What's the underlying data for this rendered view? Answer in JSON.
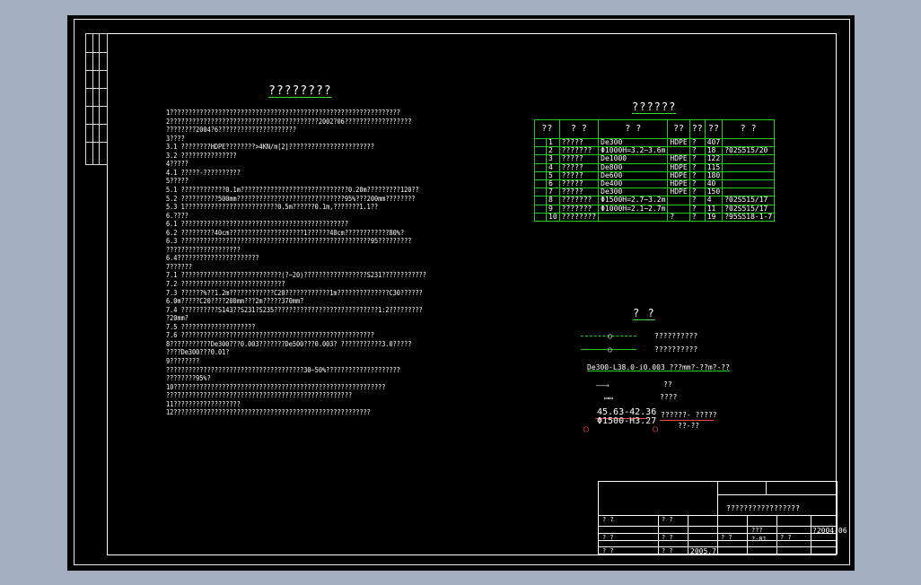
{
  "title": "????????",
  "notes": [
    "1??????????????????????????????????????????????????????????????",
    " 2????????????????????????????????????????2002?06??????????????????",
    "   ????????2004?6?????????????????????",
    "3????",
    "  3.1  ????????HDPE????????>4KN/m[2]???????????????????????",
    "  3.2  ???????????????",
    " 4?????",
    "  4.1  ?????-??????????",
    "5?????",
    "  5.1  ????????????0.1m?????????????????????????????0.20m?????????120??",
    "  5.2  ??????????500mm?????????????????????????????95%???200mm????????",
    "  5.3  1?????????????????????????0.5m??????0.1m,???????1.1??",
    "6.????",
    "  6.1  ?????????????????????????????????????????????",
    "  6.2  ?????????40cm????????????????????1??????40cm????????????80%?",
    "  6.3  ???????????????????????????????????????????????????95?????????",
    "     ????????????????????",
    "  6.4??????????????????????",
    "7??????",
    "  7.1  ???????????????????????????(?~20)?????????????????S231????????????",
    "  7.2  ????????????????????????????",
    "  7.3  ??????%??1.2m????????????C20????????????1m??????????????C30??????",
    "      6.0m?????C20????200mm???2m?????370mm?",
    "  7.4  ??????????S143??S231?S235????????????????????????????1:2?????????",
    "      ?20mm?",
    "  7.5  ????????????????????",
    "  7.6  ????????????????????????????????????????????????????",
    "8???????????De300???0.003???????De500???0.003? ???????????3.0?????",
    "      ????De300???0.01?",
    "9????????",
    "  ?????????????????????????????????????30~50%????????????????????",
    "  ????????95%?",
    "10?????????????????????????????????????????????????????????",
    "  ??????????????????????????????????????????????????",
    "11??????????????????",
    "12?????????????????????????????????????????????????????"
  ],
  "material_table": {
    "title": "??????",
    "headers": [
      "??",
      "?  ?",
      "?  ?",
      "??",
      "??",
      "??",
      "?  ?"
    ],
    "rows": [
      [
        "1",
        "?????",
        "De300",
        "HDPE",
        "?",
        "407",
        ""
      ],
      [
        "2",
        "???????",
        "Φ1000H=3.2~3.6m",
        "",
        "?",
        "18",
        "?02S515/20"
      ],
      [
        "3",
        "?????",
        "De1000",
        "HDPE",
        "?",
        "122",
        ""
      ],
      [
        "4",
        "?????",
        "De800",
        "HDPE",
        "?",
        "115",
        ""
      ],
      [
        "5",
        "?????",
        "De600",
        "HDPE",
        "?",
        "180",
        ""
      ],
      [
        "6",
        "?????",
        "De400",
        "HDPE",
        "?",
        "40",
        ""
      ],
      [
        "7",
        "?????",
        "De300",
        "HDPE",
        "?",
        "150",
        ""
      ],
      [
        "8",
        "???????",
        "Φ1500H=2.7~3.2m",
        "",
        "?",
        "4",
        "?02S515/17"
      ],
      [
        "9",
        "???????",
        "Φ1000H=2.1~2.7m",
        "",
        "?",
        "11",
        "?02S515/17"
      ],
      [
        "10",
        "????????",
        "",
        "?",
        "?",
        "19",
        "?95S518-1-7"
      ]
    ]
  },
  "legend": {
    "title": "?  ?",
    "items": [
      "??????????",
      "??????????",
      "De300-L38.0-i0.003  ???mm?-??m?-??",
      "??",
      "????",
      "45.63-42.36",
      "Φ1500-H3.27",
      "??????-  ?????",
      "??-??"
    ]
  },
  "title_block": {
    "project": "?????????????????",
    "drawing_no": "?2004-06",
    "sheet": "?-01",
    "scale": "???",
    "date": "2005.7",
    "labels": [
      "? ?",
      "? ?",
      "? ?",
      "? ?",
      "? ?",
      "? ?",
      "? ?",
      "? ?"
    ]
  }
}
